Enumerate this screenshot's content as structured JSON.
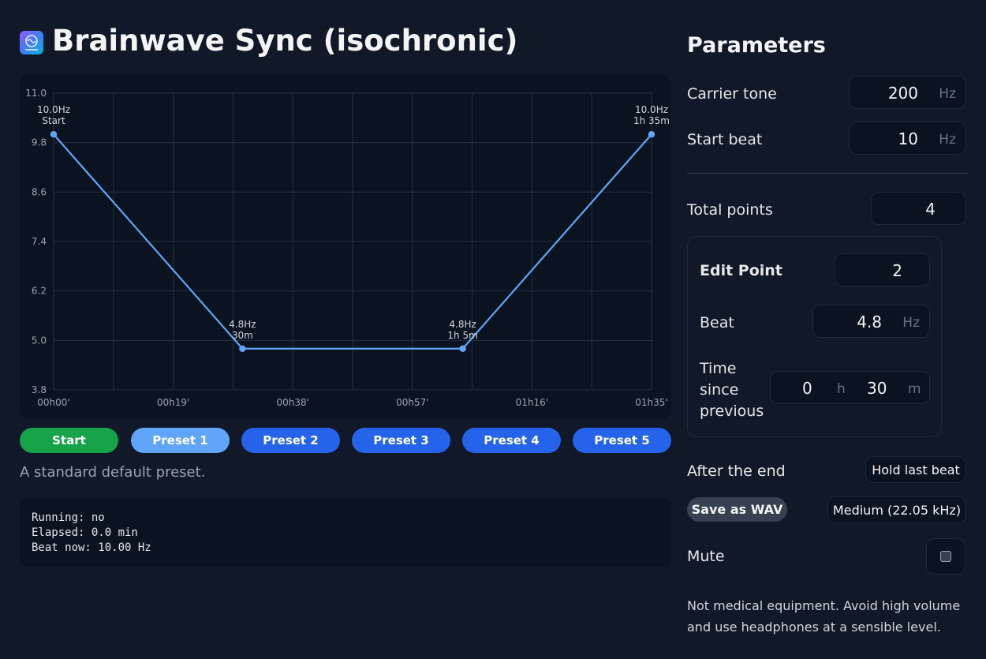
{
  "header": {
    "title": "Brainwave Sync (isochronic)",
    "icon": "brain-wave-app-icon"
  },
  "chart_data": {
    "type": "line",
    "title": "",
    "xlabel": "",
    "ylabel": "",
    "x_ticks": [
      "00h00'",
      "00h19'",
      "00h38'",
      "00h57'",
      "01h16'",
      "01h35'"
    ],
    "y_ticks": [
      "3.8",
      "5.0",
      "6.2",
      "7.4",
      "8.6",
      "9.8",
      "11.0"
    ],
    "x_range_minutes": [
      0,
      95
    ],
    "ylim": [
      3.8,
      11.0
    ],
    "grid": true,
    "series": [
      {
        "color": "#60a5fa",
        "points": [
          {
            "t_min": 0,
            "hz": 10.0,
            "label_hz": "10.0Hz",
            "label_time": "Start"
          },
          {
            "t_min": 30,
            "hz": 4.8,
            "label_hz": "4.8Hz",
            "label_time": "30m"
          },
          {
            "t_min": 65,
            "hz": 4.8,
            "label_hz": "4.8Hz",
            "label_time": "1h 5m"
          },
          {
            "t_min": 95,
            "hz": 10.0,
            "label_hz": "10.0Hz",
            "label_time": "1h 35m"
          }
        ]
      }
    ]
  },
  "controls": {
    "start_label": "Start",
    "presets": [
      "Preset 1",
      "Preset 2",
      "Preset 3",
      "Preset 4",
      "Preset 5"
    ],
    "active_preset": "Preset 1",
    "preset_description": "A standard default preset."
  },
  "status": {
    "running": "Running: no",
    "elapsed": "Elapsed: 0.0 min",
    "beat_now": "Beat now: 10.00 Hz"
  },
  "params": {
    "title": "Parameters",
    "carrier_label": "Carrier tone",
    "carrier_value": "200",
    "carrier_unit": "Hz",
    "start_beat_label": "Start beat",
    "start_beat_value": "10",
    "start_beat_unit": "Hz",
    "total_points_label": "Total points",
    "total_points_value": "4",
    "edit": {
      "title": "Edit Point",
      "point_value": "2",
      "beat_label": "Beat",
      "beat_value": "4.8",
      "beat_unit": "Hz",
      "time_label_1": "Time",
      "time_label_2": "since",
      "time_label_3": "previous",
      "hours_value": "0",
      "hours_unit": "h",
      "minutes_value": "30",
      "minutes_unit": "m"
    },
    "after_end_label": "After the end",
    "after_end_value": "Hold last beat",
    "save_label": "Save as WAV",
    "quality_value": "Medium (22.05 kHz)",
    "mute_label": "Mute",
    "mute_checked": false,
    "disclaimer": "Not medical equipment. Avoid high volume and use headphones at a sensible level."
  }
}
